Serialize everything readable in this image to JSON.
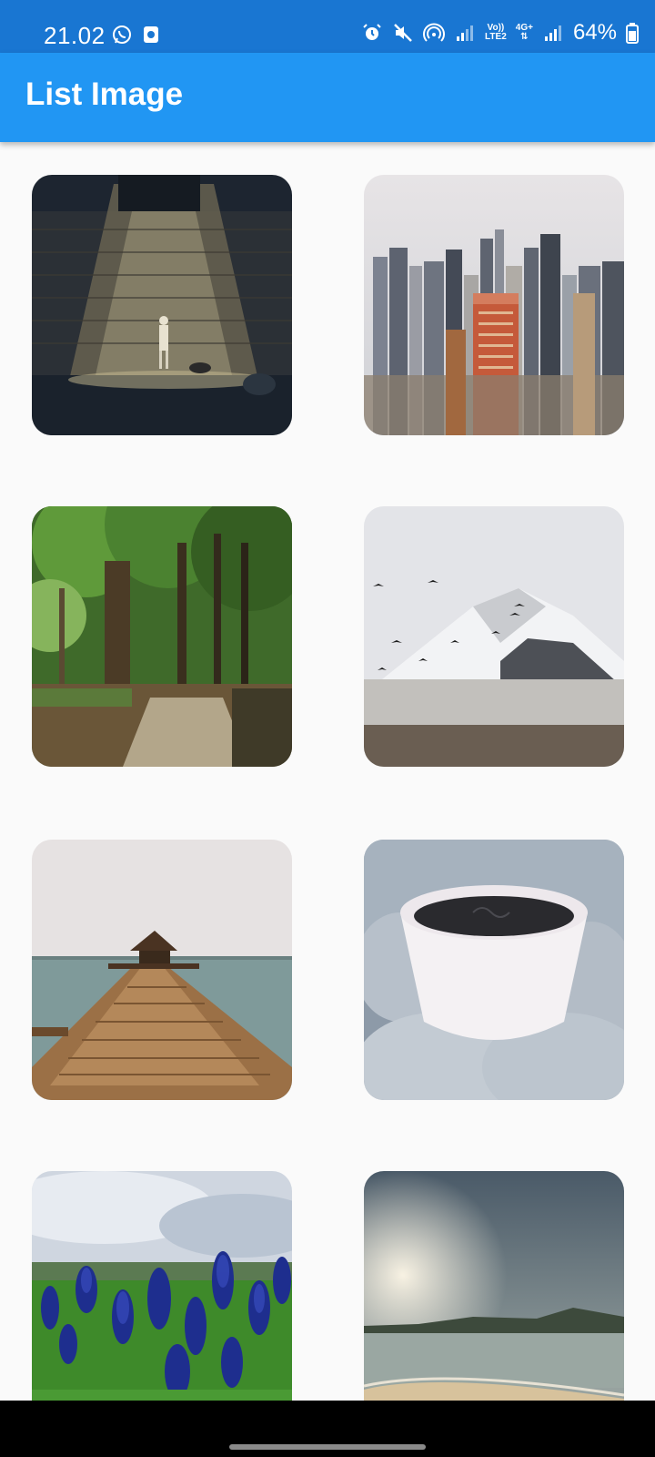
{
  "status_bar": {
    "time": "21.02",
    "battery": "64%",
    "network_top": "Vo))",
    "network_bottom": "LTE2",
    "network_gen": "4G+",
    "icons": [
      "whatsapp-icon",
      "notification-icon",
      "alarm-icon",
      "mute-icon",
      "hotspot-icon",
      "signal-icon",
      "signal-icon",
      "battery-icon"
    ],
    "color": "#1976d2"
  },
  "app_bar": {
    "title": "List Image",
    "color": "#2196f3"
  },
  "images": [
    {
      "subject": "person with dog under wall spotlight"
    },
    {
      "subject": "city skyline"
    },
    {
      "subject": "forest path"
    },
    {
      "subject": "snowy mountain with birds"
    },
    {
      "subject": "pier with gazebo"
    },
    {
      "subject": "coffee cup in knitted gloves"
    },
    {
      "subject": "blue flowers field"
    },
    {
      "subject": "beach at sunset"
    }
  ],
  "navigation": {
    "handle": "gesture-handle"
  }
}
